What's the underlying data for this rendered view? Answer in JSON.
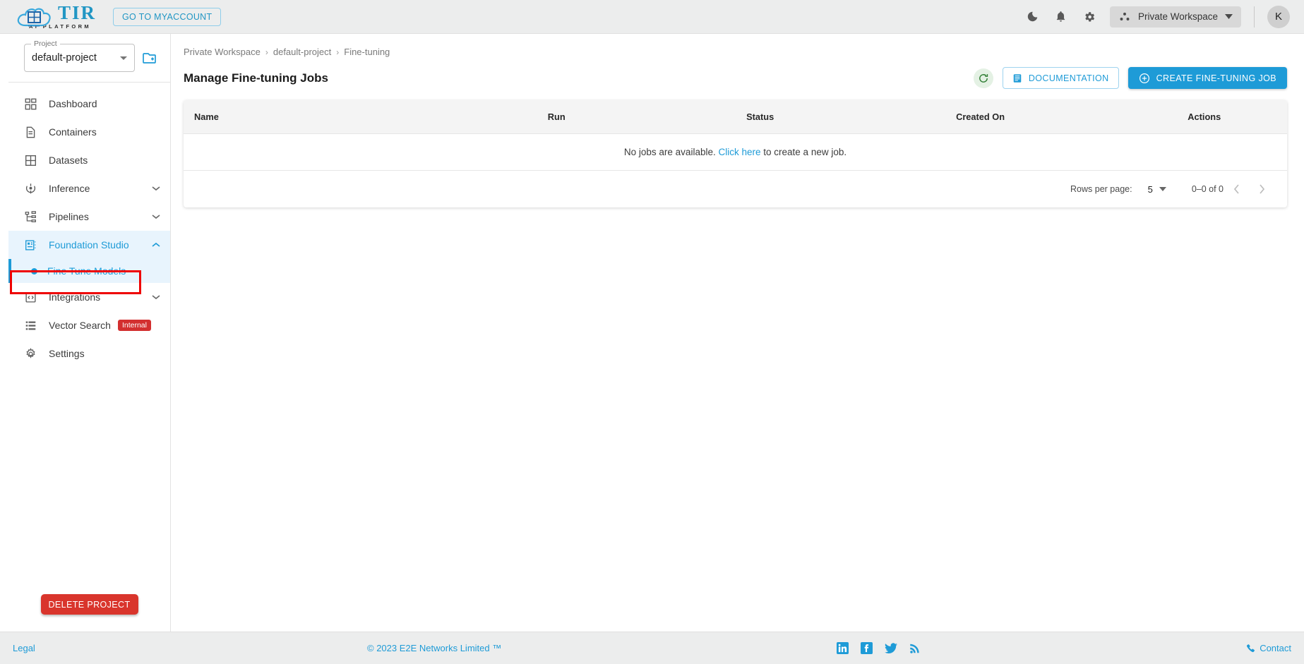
{
  "header": {
    "logo_title": "TIR",
    "logo_subtitle": "AI PLATFORM",
    "myaccount_label": "GO TO MYACCOUNT",
    "dark_mode_icon": "moon-icon",
    "notifications_icon": "bell-icon",
    "settings_icon": "gear-icon",
    "workspace_label": "Private Workspace",
    "avatar_initial": "K"
  },
  "sidebar": {
    "project_legend": "Project",
    "project_value": "default-project",
    "add_project_icon": "add-folder-icon",
    "items": [
      {
        "label": "Dashboard",
        "icon": "dashboard-icon",
        "expandable": false,
        "active": false
      },
      {
        "label": "Containers",
        "icon": "document-icon",
        "expandable": false,
        "active": false
      },
      {
        "label": "Datasets",
        "icon": "grid-icon",
        "expandable": false,
        "active": false
      },
      {
        "label": "Inference",
        "icon": "inference-icon",
        "expandable": true,
        "active": false
      },
      {
        "label": "Pipelines",
        "icon": "pipelines-icon",
        "expandable": true,
        "active": false
      },
      {
        "label": "Foundation Studio",
        "icon": "foundation-studio-icon",
        "expandable": true,
        "active": true
      },
      {
        "label": "Integrations",
        "icon": "integrations-icon",
        "expandable": true,
        "active": false
      },
      {
        "label": "Vector Search",
        "icon": "list-icon",
        "expandable": false,
        "active": false,
        "badge": "Internal"
      },
      {
        "label": "Settings",
        "icon": "settings-gear-icon",
        "expandable": false,
        "active": false
      }
    ],
    "subnav": {
      "label": "Fine Tune Models",
      "highlighted": true
    },
    "delete_project_label": "DELETE PROJECT"
  },
  "main": {
    "breadcrumb": [
      "Private Workspace",
      "default-project",
      "Fine-tuning"
    ],
    "page_title": "Manage Fine-tuning Jobs",
    "refresh_icon": "refresh-icon",
    "documentation_label": "DOCUMENTATION",
    "documentation_icon": "book-icon",
    "create_job_label": "CREATE FINE-TUNING JOB",
    "create_job_icon": "plus-circle-icon",
    "table": {
      "columns": [
        "Name",
        "Run",
        "Status",
        "Created On",
        "Actions"
      ],
      "rows": [],
      "empty_text_before": "No jobs are available.",
      "empty_link": "Click here",
      "empty_text_after": "to create a new job."
    },
    "pagination": {
      "rows_per_page_label": "Rows per page:",
      "rows_per_page_value": "5",
      "range_label": "0–0 of 0",
      "prev_icon": "chevron-left-icon",
      "next_icon": "chevron-right-icon"
    }
  },
  "footer": {
    "legal_label": "Legal",
    "copyright": "© 2023 E2E Networks Limited ™",
    "social": [
      "linkedin-icon",
      "facebook-icon",
      "twitter-icon",
      "rss-icon"
    ],
    "contact_label": "Contact",
    "contact_icon": "phone-icon"
  },
  "colors": {
    "accent_blue": "#1e9bd7",
    "danger_red": "#d9352c",
    "annotation_red": "#ee0000",
    "header_bg": "#eceded"
  }
}
